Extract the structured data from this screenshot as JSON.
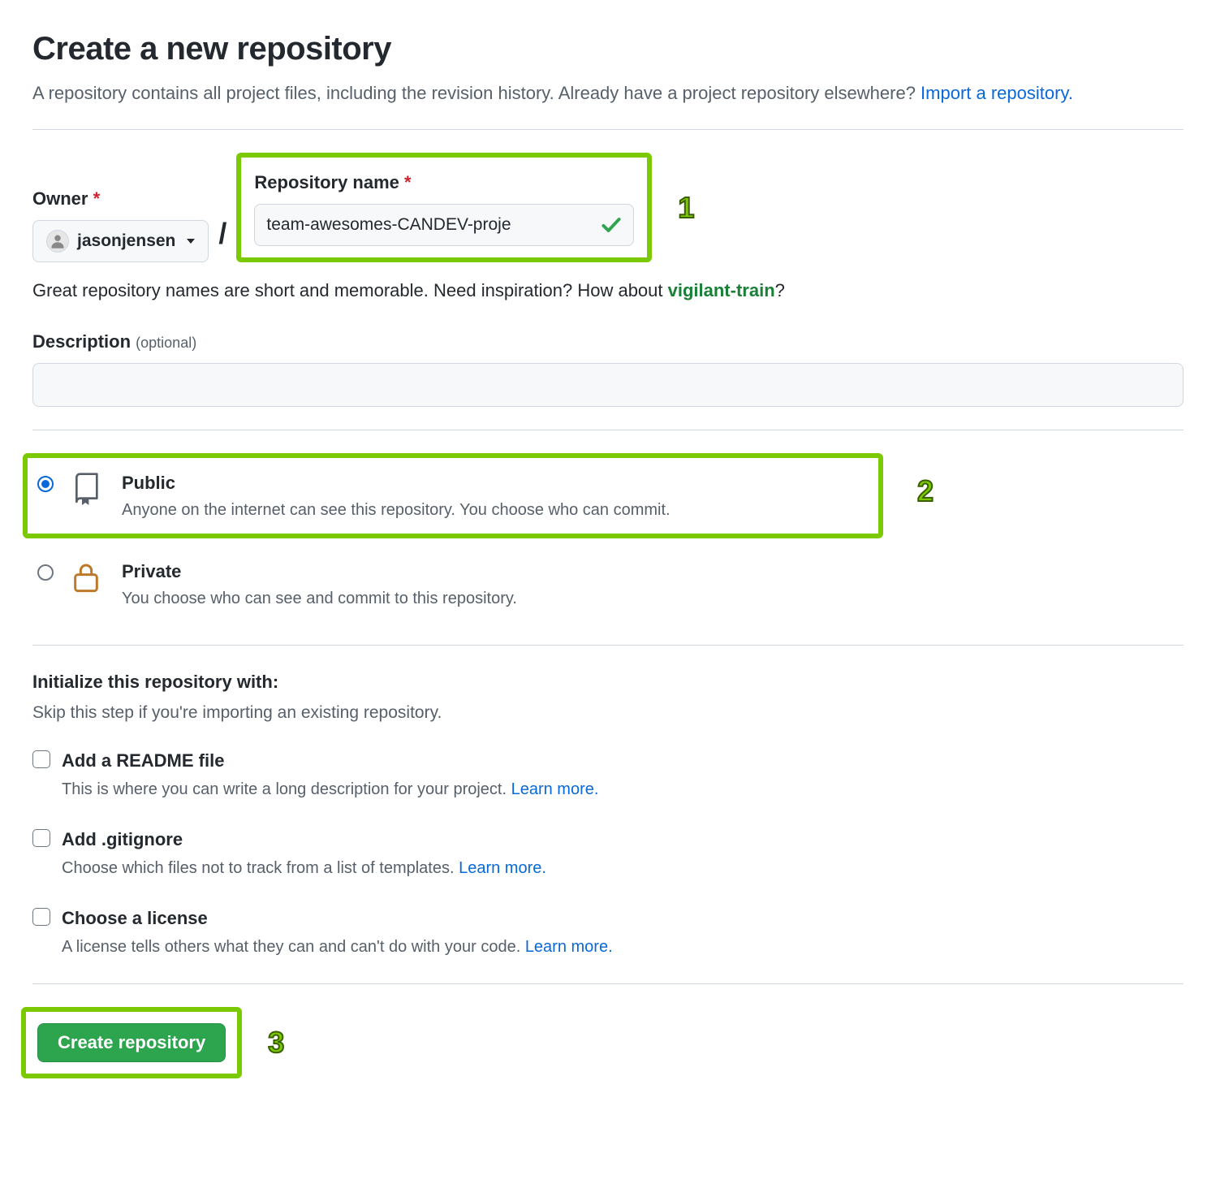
{
  "header": {
    "title": "Create a new repository",
    "subtitle_pre": "A repository contains all project files, including the revision history. Already have a project repository elsewhere? ",
    "import_link": "Import a repository."
  },
  "owner": {
    "label": "Owner",
    "required_mark": "*",
    "username": "jasonjensen"
  },
  "slash": "/",
  "repo_name": {
    "label": "Repository name",
    "required_mark": "*",
    "value": "team-awesomes-CANDEV-proje"
  },
  "name_help": {
    "pre": "Great repository names are short and memorable. Need inspiration? How about ",
    "suggestion": "vigilant-train",
    "post": "?"
  },
  "description": {
    "label": "Description",
    "optional": "(optional)",
    "value": ""
  },
  "visibility": {
    "public": {
      "title": "Public",
      "desc": "Anyone on the internet can see this repository. You choose who can commit."
    },
    "private": {
      "title": "Private",
      "desc": "You choose who can see and commit to this repository."
    }
  },
  "init": {
    "title": "Initialize this repository with:",
    "subtitle": "Skip this step if you're importing an existing repository.",
    "readme": {
      "title": "Add a README file",
      "desc_pre": "This is where you can write a long description for your project. ",
      "learn_more": "Learn more."
    },
    "gitignore": {
      "title": "Add .gitignore",
      "desc_pre": "Choose which files not to track from a list of templates. ",
      "learn_more": "Learn more."
    },
    "license": {
      "title": "Choose a license",
      "desc_pre": "A license tells others what they can and can't do with your code. ",
      "learn_more": "Learn more."
    }
  },
  "submit": {
    "label": "Create repository"
  },
  "annotations": {
    "one": "1",
    "two": "2",
    "three": "3"
  }
}
